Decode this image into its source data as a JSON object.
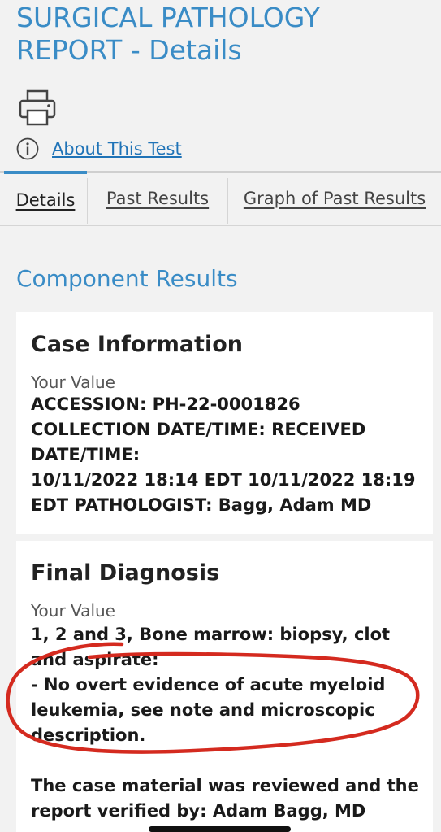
{
  "header": {
    "title": "SURGICAL PATHOLOGY REPORT - Details",
    "about_link": "About This Test"
  },
  "icons": {
    "print": "printer-icon",
    "info": "info-icon"
  },
  "tabs": [
    {
      "label": "Details",
      "active": true
    },
    {
      "label": "Past Results",
      "active": false
    },
    {
      "label": "Graph of Past Results",
      "active": false
    }
  ],
  "component_results": {
    "heading": "Component Results",
    "case_information": {
      "title": "Case Information",
      "value_label": "Your Value",
      "value": "ACCESSION: PH-22-0001826\nCOLLECTION DATE/TIME: RECEIVED\nDATE/TIME:\n10/11/2022 18:14 EDT 10/11/2022 18:19\nEDT PATHOLOGIST: Bagg, Adam MD"
    },
    "final_diagnosis": {
      "title": "Final Diagnosis",
      "value_label": "Your Value",
      "value": "1, 2 and 3, Bone marrow: biopsy, clot\nand aspirate:\n- No overt evidence of acute myeloid\nleukemia, see note and microscopic\ndescription.",
      "review_text": "The case material was reviewed and the report verified by: Adam Bagg, MD"
    }
  },
  "colors": {
    "accent": "#3a8cc6",
    "link": "#1f73b7",
    "annotation": "#d42a1f"
  }
}
